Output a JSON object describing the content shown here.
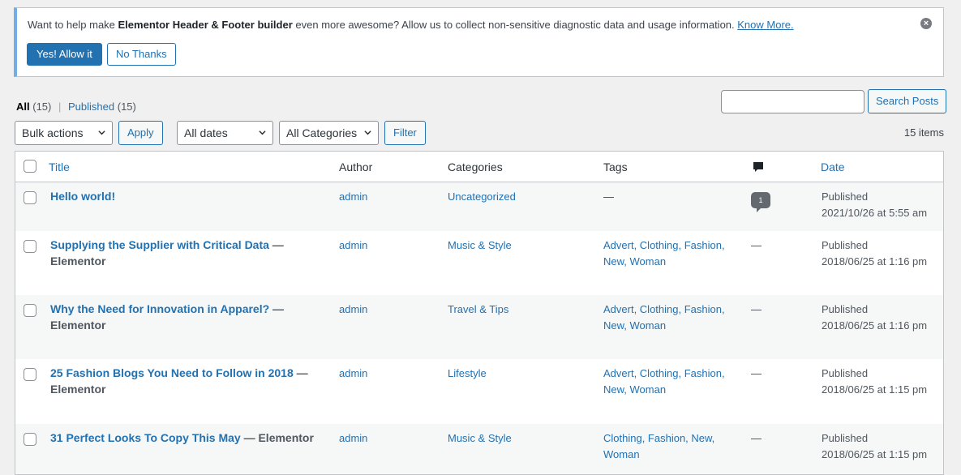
{
  "notice": {
    "text_before": "Want to help make ",
    "plugin_name": "Elementor Header & Footer builder",
    "text_after": " even more awesome? Allow us to collect non-sensitive diagnostic data and usage information. ",
    "know_more": "Know More.",
    "allow_label": "Yes! Allow it",
    "no_label": "No Thanks",
    "close_symbol": "×"
  },
  "views": {
    "all_label": "All",
    "all_count": "(15)",
    "separator": "|",
    "published_label": "Published",
    "published_count": "(15)"
  },
  "search": {
    "value": "",
    "button_label": "Search Posts"
  },
  "tablenav": {
    "bulk_actions": "Bulk actions",
    "apply": "Apply",
    "dates": "All dates",
    "categories": "All Categories",
    "filter": "Filter",
    "items_count": "15 items"
  },
  "columns": {
    "title": "Title",
    "author": "Author",
    "categories": "Categories",
    "tags": "Tags",
    "comments_icon": "comment-icon",
    "date": "Date"
  },
  "posts": [
    {
      "title": "Hello world!",
      "state": "",
      "author": "admin",
      "categories": "Uncategorized",
      "tags_line1": "—",
      "tags_line2": "",
      "comments": "1",
      "date_status": "Published",
      "date_value": "2021/10/26 at 5:55 am"
    },
    {
      "title": "Supplying the Supplier with Critical Data",
      "state": " — Elementor",
      "author": "admin",
      "categories": "Music & Style",
      "tags_line1": "Advert, Clothing, Fashion,",
      "tags_line2": "New, Woman",
      "comments": "—",
      "date_status": "Published",
      "date_value": "2018/06/25 at 1:16 pm"
    },
    {
      "title": "Why the Need for Innovation in Apparel?",
      "state": " — Elementor",
      "author": "admin",
      "categories": "Travel & Tips",
      "tags_line1": "Advert, Clothing, Fashion,",
      "tags_line2": "New, Woman",
      "comments": "—",
      "date_status": "Published",
      "date_value": "2018/06/25 at 1:16 pm"
    },
    {
      "title": "25 Fashion Blogs You Need to Follow in 2018",
      "state": " — Elementor",
      "author": "admin",
      "categories": "Lifestyle",
      "tags_line1": "Advert, Clothing, Fashion,",
      "tags_line2": "New, Woman",
      "comments": "—",
      "date_status": "Published",
      "date_value": "2018/06/25 at 1:15 pm"
    },
    {
      "title": "31 Perfect Looks To Copy This May",
      "state": " — Elementor",
      "author": "admin",
      "categories": "Music & Style",
      "tags_line1": "Clothing, Fashion, New,",
      "tags_line2": "Woman",
      "comments": "—",
      "date_status": "Published",
      "date_value": "2018/06/25 at 1:15 pm"
    }
  ],
  "colors": {
    "link": "#2271b1",
    "notice_border": "#72aee6",
    "background": "#f0f0f1",
    "alt_row": "#f6f7f7"
  }
}
